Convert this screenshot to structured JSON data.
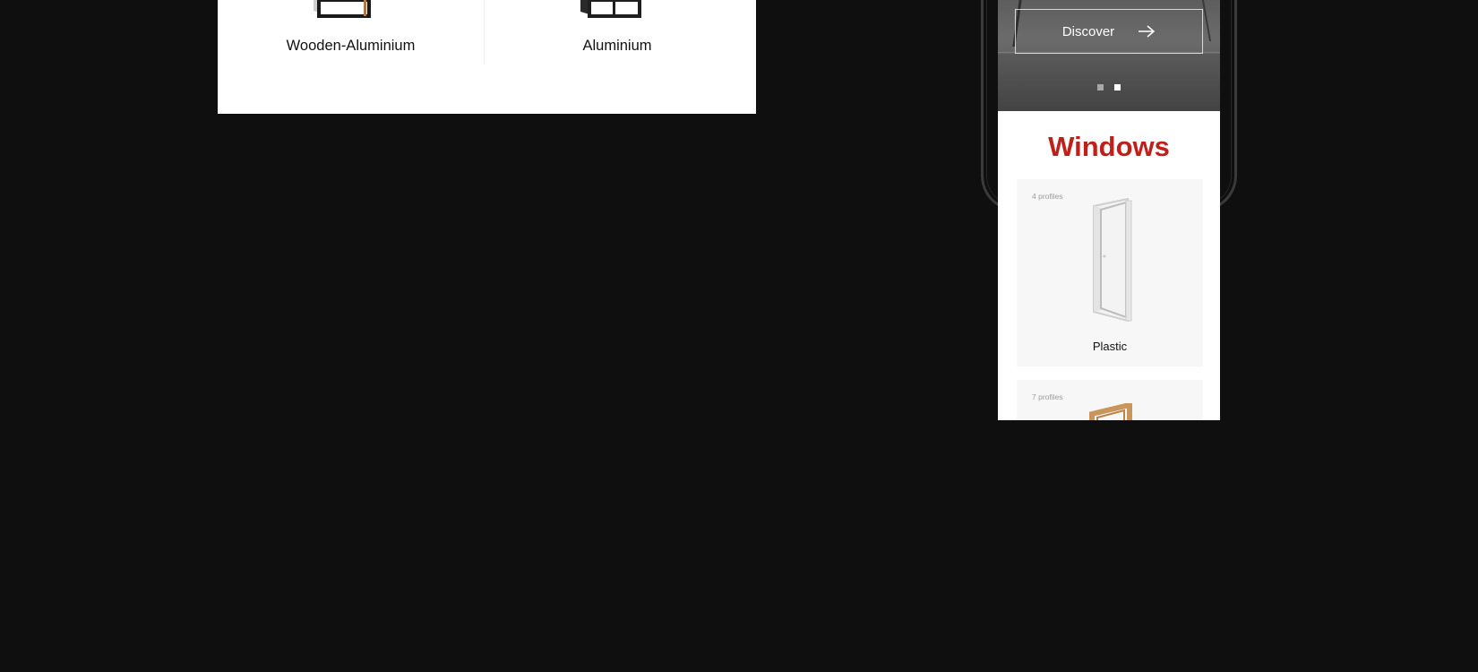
{
  "desktop": {
    "products": [
      {
        "label": "Wooden-Aluminium"
      },
      {
        "label": "Aluminium"
      }
    ]
  },
  "mobile": {
    "hero": {
      "button_label": "Discover",
      "button_icon": "arrow-right-icon",
      "slides": 2,
      "active_slide": 2
    },
    "section_title": "Windows",
    "cards": [
      {
        "profiles": "4 profiles",
        "name": "Plastic",
        "material": "plastic"
      },
      {
        "profiles": "7 profiles",
        "name": "",
        "material": "wood"
      }
    ]
  },
  "colors": {
    "page_background": "#0f0f0f",
    "accent": "#c0201b",
    "card_background": "#f7f7f7",
    "wood_frame": "#c8965a"
  }
}
